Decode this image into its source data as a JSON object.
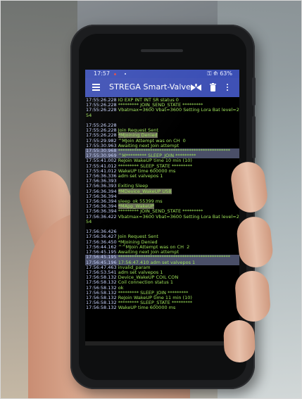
{
  "statusbar": {
    "time": "17:57",
    "right": "⚿ ⟰ 63%"
  },
  "appbar": {
    "title": "STREGA Smart-Valve",
    "icons": [
      "menu-icon",
      "valve-icon",
      "trash-icon",
      "more-icon"
    ]
  },
  "colors": {
    "appbar": "#3f51b5",
    "log_text": "#9fe35a",
    "timestamp": "#c9d4ff",
    "screen_bg": "#000000"
  },
  "log": [
    {
      "t": "17:55:26.228",
      "m": "IO EXP INT INT SR status 0"
    },
    {
      "t": "17:55:26.228",
      "m": "********* JOIN_SEND_STATE *********"
    },
    {
      "t": "17:55:26.228",
      "m": "Vbatmax=3600 Vbat=3600 Setting Lora Bat level=254"
    },
    {
      "t": "",
      "m": ""
    },
    {
      "t": "17:55:26.228",
      "m": ""
    },
    {
      "t": "17:55:26.228",
      "m": "Join Request Sent"
    },
    {
      "t": "17:55:26.228",
      "m": "*MJoining Denied",
      "hl": true
    },
    {
      "t": "17:55:29.982",
      "m": "^MJoin Attempt was on CH  0"
    },
    {
      "t": "17:55:30.963",
      "m": "Awaiting next Join attempt"
    },
    {
      "t": "17:55:30.968",
      "m": "*************************************************",
      "sel": true
    },
    {
      "t": "17:55:30.969",
      "m": "^M********* SLEEP_JOIN *********",
      "sel": true
    },
    {
      "t": "17:55:41.002",
      "m": "ReJoin WakeUP time 10 min (10)"
    },
    {
      "t": "17:55:41.012",
      "m": "********* SLEEP_STATE *********"
    },
    {
      "t": "17:55:41.012",
      "m": "WakeUP time 600000 ms"
    },
    {
      "t": "17:56:36.336",
      "m": "adm set valvepos 1"
    },
    {
      "t": "17:56:36.393",
      "m": ""
    },
    {
      "t": "17:56:36.393",
      "m": "Exiting Sleep"
    },
    {
      "t": "17:56:36.394",
      "m": "*MDevice_WakeUP USB",
      "hl": true
    },
    {
      "t": "17:56:36.394",
      "m": ""
    },
    {
      "t": "17:56:36.394",
      "m": "sleep_ok 55399 ms"
    },
    {
      "t": "17:56:36.394",
      "m": "*MApp_WakeUP",
      "hl": true
    },
    {
      "t": "17:56:36.394",
      "m": "********* JOIN_SEND_STATE *********"
    },
    {
      "t": "17:56:36.422",
      "m": "Vbatmax=3600 Vbat=3600 Setting Lora Bat level=254"
    },
    {
      "t": "",
      "m": ""
    },
    {
      "t": "17:56:36.426",
      "m": ""
    },
    {
      "t": "17:56:36.427",
      "m": "Join Request Sent"
    },
    {
      "t": "17:56:36.450",
      "m": "*MJoining Denied"
    },
    {
      "t": "17:56:44.162",
      "m": "^^MJoin Attempt was on CH  2"
    },
    {
      "t": "17:56:45.195",
      "m": "Awaiting next Join attempt"
    },
    {
      "t": "17:56:45.195",
      "m": "*************************************************",
      "sel": true
    },
    {
      "t": "17:56:45.196",
      "m": "17:56:47.410 adm set valvepos 1",
      "sel": true
    },
    {
      "t": "17:56:47.463",
      "m": "invalid_param"
    },
    {
      "t": "17:56:53.541",
      "m": "adm set valvepos 1"
    },
    {
      "t": "17:56:58.132",
      "m": "Device_WakeUP COIL CON"
    },
    {
      "t": "17:56:58.132",
      "m": "Coil connection status 1"
    },
    {
      "t": "17:56:58.132",
      "m": "ok"
    },
    {
      "t": "17:56:58.132",
      "m": "********* SLEEP_JOIN *********"
    },
    {
      "t": "17:56:58.132",
      "m": "ReJoin WakeUP time 11 min (10)"
    },
    {
      "t": "17:56:58.132",
      "m": "********* SLEEP_STATE *********"
    },
    {
      "t": "17:56:58.132",
      "m": "WakeUP time 600000 ms"
    }
  ]
}
